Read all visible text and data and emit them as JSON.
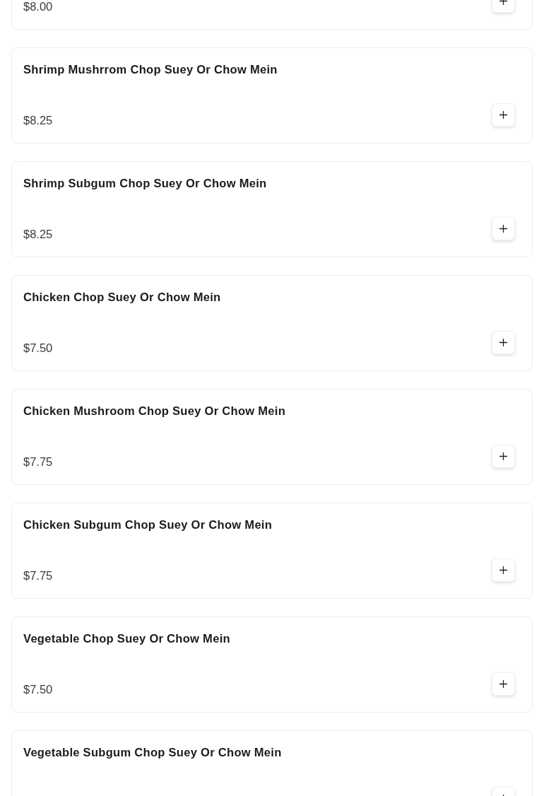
{
  "menu_items": [
    {
      "price": "$8.00"
    },
    {
      "name": "Shrimp Mushrrom Chop Suey Or Chow Mein",
      "price": "$8.25"
    },
    {
      "name": "Shrimp Subgum Chop Suey Or Chow Mein",
      "price": "$8.25"
    },
    {
      "name": "Chicken Chop Suey Or Chow Mein",
      "price": "$7.50"
    },
    {
      "name": "Chicken Mushroom Chop Suey Or Chow Mein",
      "price": "$7.75"
    },
    {
      "name": "Chicken Subgum Chop Suey Or Chow Mein",
      "price": "$7.75"
    },
    {
      "name": "Vegetable Chop Suey Or Chow Mein",
      "price": "$7.50"
    },
    {
      "name": "Vegetable Subgum Chop Suey Or Chow Mein"
    }
  ]
}
